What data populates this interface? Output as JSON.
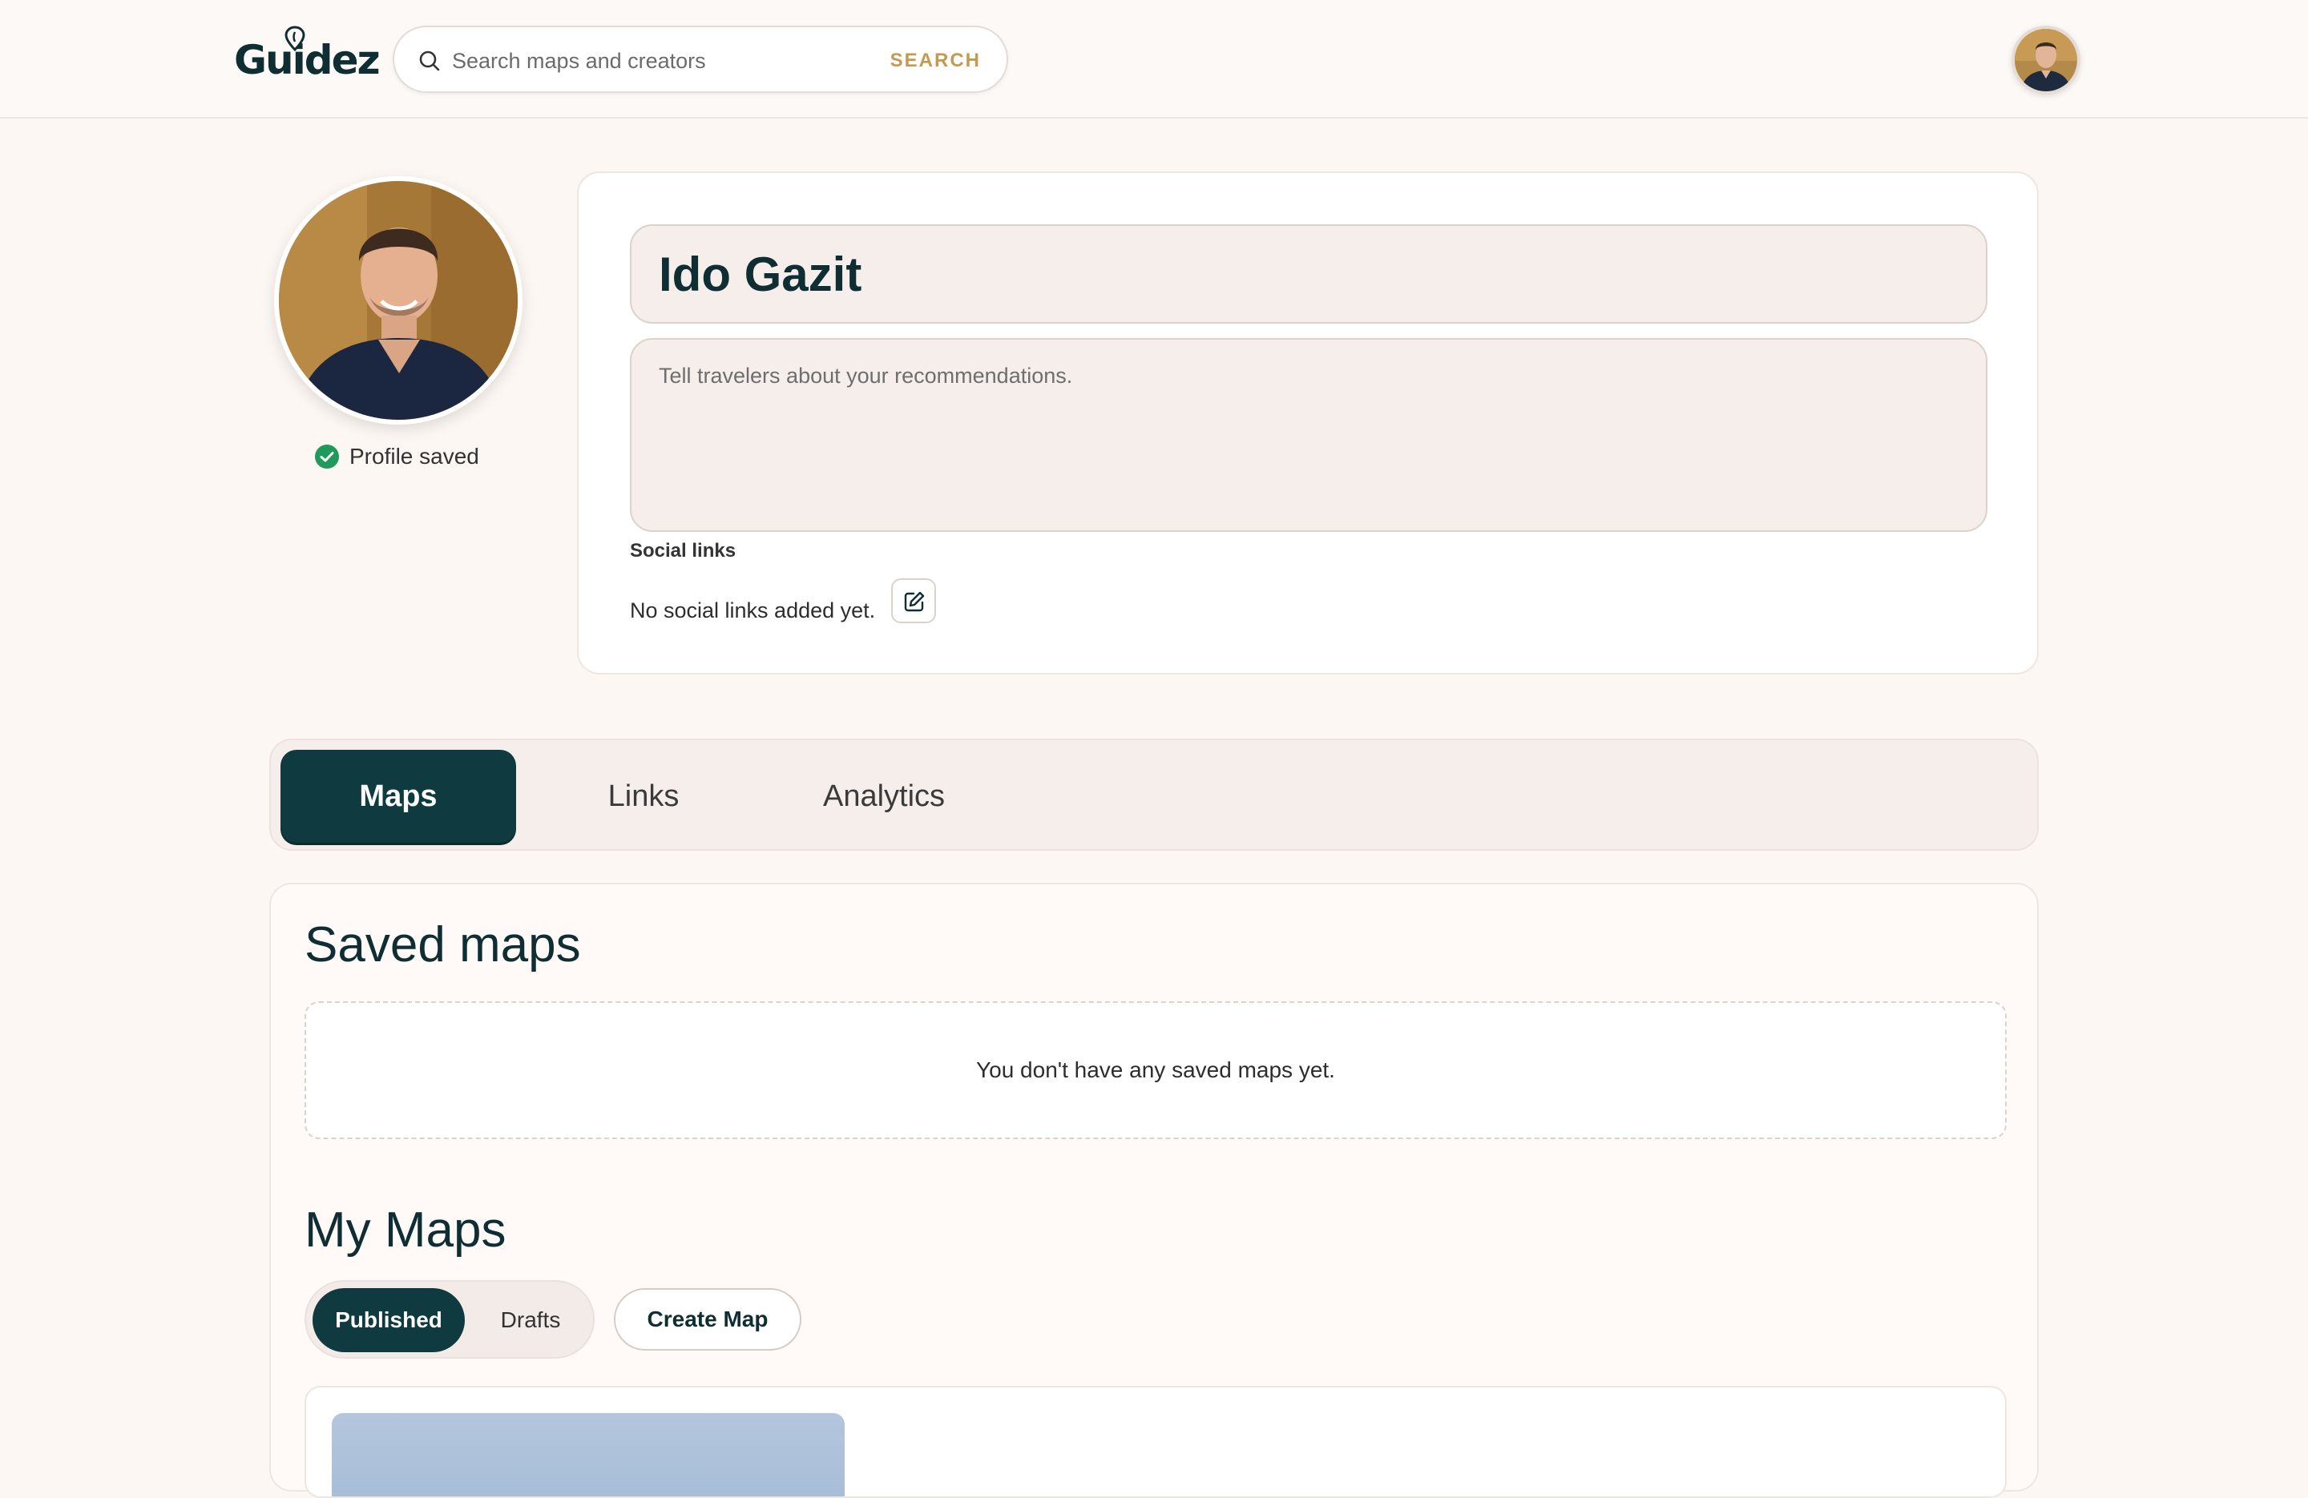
{
  "app": {
    "logo_text": "Guidez"
  },
  "search": {
    "placeholder": "Search maps and creators",
    "button_label": "SEARCH"
  },
  "profile": {
    "name": "Ido Gazit",
    "bio_placeholder": "Tell travelers about your recommendations.",
    "status": "Profile saved",
    "social_links_label": "Social links",
    "social_links_empty": "No social links added yet."
  },
  "tabs": [
    {
      "label": "Maps",
      "active": true
    },
    {
      "label": "Links",
      "active": false
    },
    {
      "label": "Analytics",
      "active": false
    }
  ],
  "saved_maps": {
    "title": "Saved maps",
    "empty_message": "You don't have any saved maps yet."
  },
  "my_maps": {
    "title": "My Maps",
    "filters": [
      {
        "label": "Published",
        "active": true
      },
      {
        "label": "Drafts",
        "active": false
      }
    ],
    "create_label": "Create Map"
  },
  "colors": {
    "brand_dark": "#0f3a40",
    "accent_gold": "#c49a52",
    "success_green": "#1f9a5b",
    "page_bg": "#fdf7f4"
  }
}
